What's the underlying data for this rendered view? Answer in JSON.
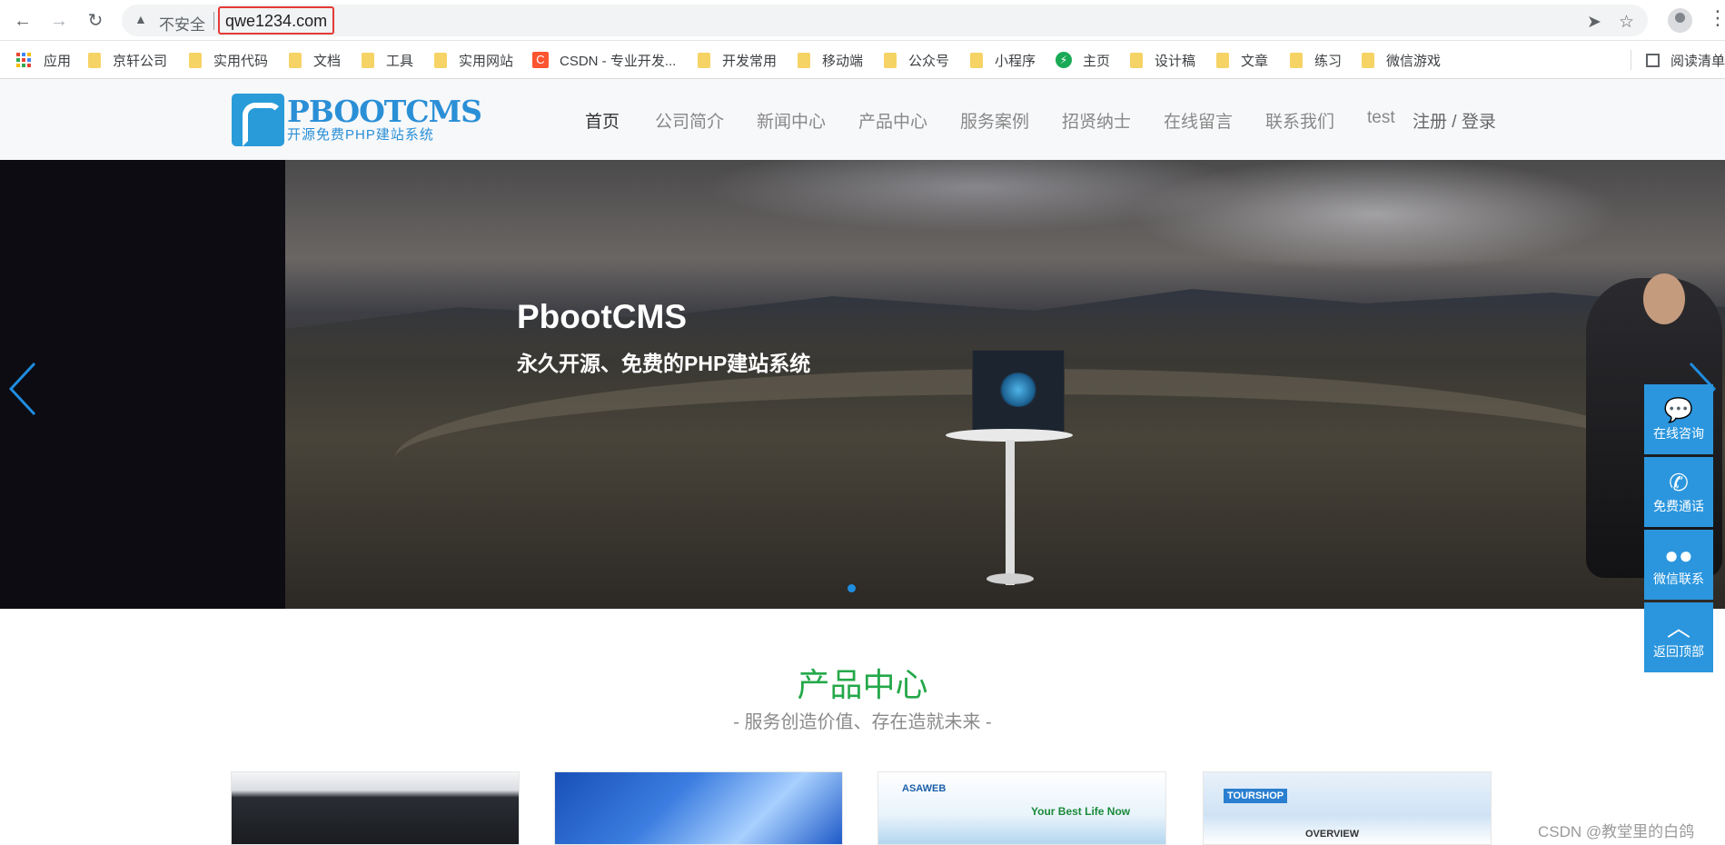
{
  "browser": {
    "security_label": "不安全",
    "url": "qwe1234.com",
    "bookmarks": [
      {
        "label": "应用",
        "icon": "apps-grid-icon"
      },
      {
        "label": "京轩公司",
        "icon": "folder-icon"
      },
      {
        "label": "实用代码",
        "icon": "folder-icon"
      },
      {
        "label": "文档",
        "icon": "folder-icon"
      },
      {
        "label": "工具",
        "icon": "folder-icon"
      },
      {
        "label": "实用网站",
        "icon": "folder-icon"
      },
      {
        "label": "CSDN - 专业开发...",
        "icon": "csdn-icon"
      },
      {
        "label": "开发常用",
        "icon": "folder-icon"
      },
      {
        "label": "移动端",
        "icon": "folder-icon"
      },
      {
        "label": "公众号",
        "icon": "folder-icon"
      },
      {
        "label": "小程序",
        "icon": "folder-icon"
      },
      {
        "label": "主页",
        "icon": "home-icon"
      },
      {
        "label": "设计稿",
        "icon": "folder-icon"
      },
      {
        "label": "文章",
        "icon": "folder-icon"
      },
      {
        "label": "练习",
        "icon": "folder-icon"
      },
      {
        "label": "微信游戏",
        "icon": "folder-icon"
      }
    ],
    "reading_list": "阅读清单"
  },
  "site": {
    "logo_title": "PBOOTCMS",
    "logo_subtitle": "开源免费PHP建站系统",
    "nav": [
      "首页",
      "公司简介",
      "新闻中心",
      "产品中心",
      "服务案例",
      "招贤纳士",
      "在线留言",
      "联系我们",
      "test"
    ],
    "auth": "注册 / 登录",
    "hero_title": "PbootCMS",
    "hero_subtitle": "永久开源、免费的PHP建站系统",
    "float": [
      {
        "label": "在线咨询",
        "icon": "chat-icon"
      },
      {
        "label": "免费通话",
        "icon": "phone-icon"
      },
      {
        "label": "微信联系",
        "icon": "wechat-icon"
      },
      {
        "label": "返回顶部",
        "icon": "arrow-up-icon"
      }
    ],
    "section_title": "产品中心",
    "section_subtitle": "- 服务创造价值、存在造就未来 -",
    "product_captions": [
      "ASAWEB",
      "Your Best Life Now",
      "TOURSHOP",
      "OVERVIEW"
    ],
    "watermark": "CSDN @教堂里的白鸽"
  },
  "colors": {
    "accent_blue": "#2b96de",
    "section_green": "#25a84a",
    "url_highlight": "#e53935"
  }
}
